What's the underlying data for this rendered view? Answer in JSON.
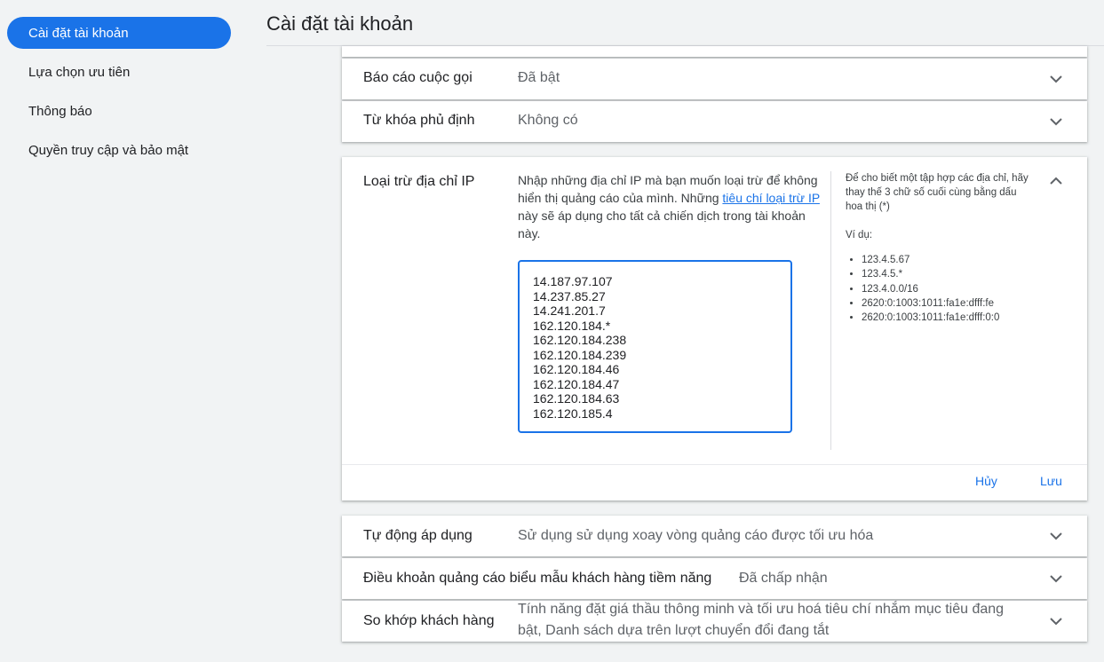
{
  "sidebar": {
    "items": [
      {
        "label": "Cài đặt tài khoản",
        "active": true
      },
      {
        "label": "Lựa chọn ưu tiên"
      },
      {
        "label": "Thông báo"
      },
      {
        "label": "Quyền truy cập và bảo mật"
      }
    ]
  },
  "page": {
    "title": "Cài đặt tài khoản"
  },
  "settings": {
    "call_reports": {
      "label": "Báo cáo cuộc gọi",
      "value": "Đã bật"
    },
    "negative_keywords": {
      "label": "Từ khóa phủ định",
      "value": "Không có"
    },
    "ip_exclusion": {
      "label": "Loại trừ địa chỉ IP",
      "desc_before": "Nhập những địa chỉ IP mà bạn muốn loại trừ để không hiển thị quảng cáo của mình. Những ",
      "desc_link": "tiêu chí loại trừ IP",
      "desc_after": " này sẽ áp dụng cho tất cả chiến dịch trong tài khoản này.",
      "ips": [
        "14.187.97.107",
        "14.237.85.27",
        "14.241.201.7",
        "162.120.184.*",
        "162.120.184.238",
        "162.120.184.239",
        "162.120.184.46",
        "162.120.184.47",
        "162.120.184.63",
        "162.120.185.4"
      ],
      "help_text": "Để cho biết một tập hợp các địa chỉ, hãy thay thế 3 chữ số cuối cùng bằng dấu hoa thị (*)",
      "examples_label": "Ví dụ:",
      "examples": [
        "123.4.5.67",
        "123.4.5.*",
        "123.4.0.0/16",
        "2620:0:1003:1011:fa1e:dfff:fe",
        "2620:0:1003:1011:fa1e:dfff:0:0"
      ],
      "cancel_label": "Hủy",
      "save_label": "Lưu"
    },
    "auto_apply": {
      "label": "Tự động áp dụng",
      "value": "Sử dụng sử dụng xoay vòng quảng cáo được tối ưu hóa"
    },
    "lead_form_terms": {
      "label": "Điều khoản quảng cáo biểu mẫu khách hàng tiềm năng",
      "value": "Đã chấp nhận"
    },
    "customer_match": {
      "label": "So khớp khách hàng",
      "value_line1": "Tính năng đặt giá thầu thông minh và tối ưu hoá tiêu chí nhắm mục tiêu đang",
      "value_line2": "bật, Danh sách dựa trên lượt chuyển đổi đang tắt"
    }
  },
  "colors": {
    "accent": "#1a73e8",
    "background": "#f1f3f4"
  },
  "icons": {
    "collapsed": "chevron-down-icon",
    "expanded": "chevron-up-icon"
  }
}
